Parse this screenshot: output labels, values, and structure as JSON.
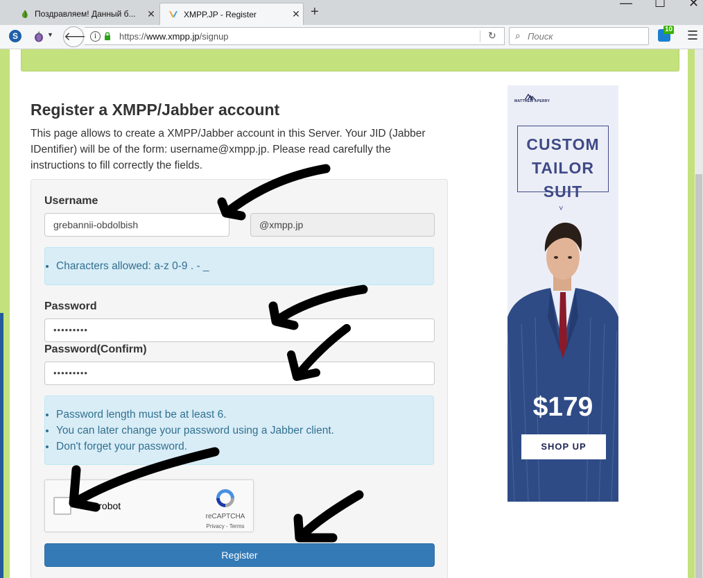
{
  "browser": {
    "tabs": [
      {
        "title": "Поздравляем! Данный б...",
        "active": false
      },
      {
        "title": "XMPP.JP - Register",
        "active": true
      }
    ],
    "url": {
      "scheme": "https://",
      "host": "www.xmpp.jp",
      "path": "/signup"
    },
    "search_placeholder": "Поиск",
    "extension_badge": "10",
    "new_tab_label": "+",
    "tab_close_glyph": "✕",
    "window_controls": [
      "—",
      "☐",
      "✕"
    ]
  },
  "page": {
    "title": "Register a XMPP/Jabber account",
    "intro": "This page allows to create a XMPP/Jabber account in this Server. Your JID (Jabber IDentifier) will be of the form: username@xmpp.jp. Please read carefully the instructions to fill correctly the fields.",
    "form": {
      "username_label": "Username",
      "username_value": "grebannii-obdolbish",
      "domain_value": "@xmpp.jp",
      "username_hint": "Characters allowed: a-z 0-9 . - _",
      "password_label": "Password",
      "password_value": "•••••••••",
      "password_confirm_label": "Password(Confirm)",
      "password_confirm_value": "•••••••••",
      "password_hints": [
        "Password length must be at least 6.",
        "You can later change your password using a Jabber client.",
        "Don't forget your password."
      ],
      "captcha": {
        "label": "ot a robot",
        "brand": "reCAPTCHA",
        "links": "Privacy - Terms",
        "checked": false
      },
      "submit_label": "Register"
    }
  },
  "ad": {
    "brand": "MATTHEW APERRY",
    "headline": [
      "CUSTOM",
      "TAILOR",
      "SUIT"
    ],
    "caret": "˅",
    "price": "$179",
    "cta": "SHOP UP"
  },
  "colors": {
    "alert_green": "#c3e27d",
    "button_blue": "#337ab7",
    "info_bg": "#d9edf7",
    "info_text": "#31708f",
    "ad_navy": "#3f4a86"
  }
}
